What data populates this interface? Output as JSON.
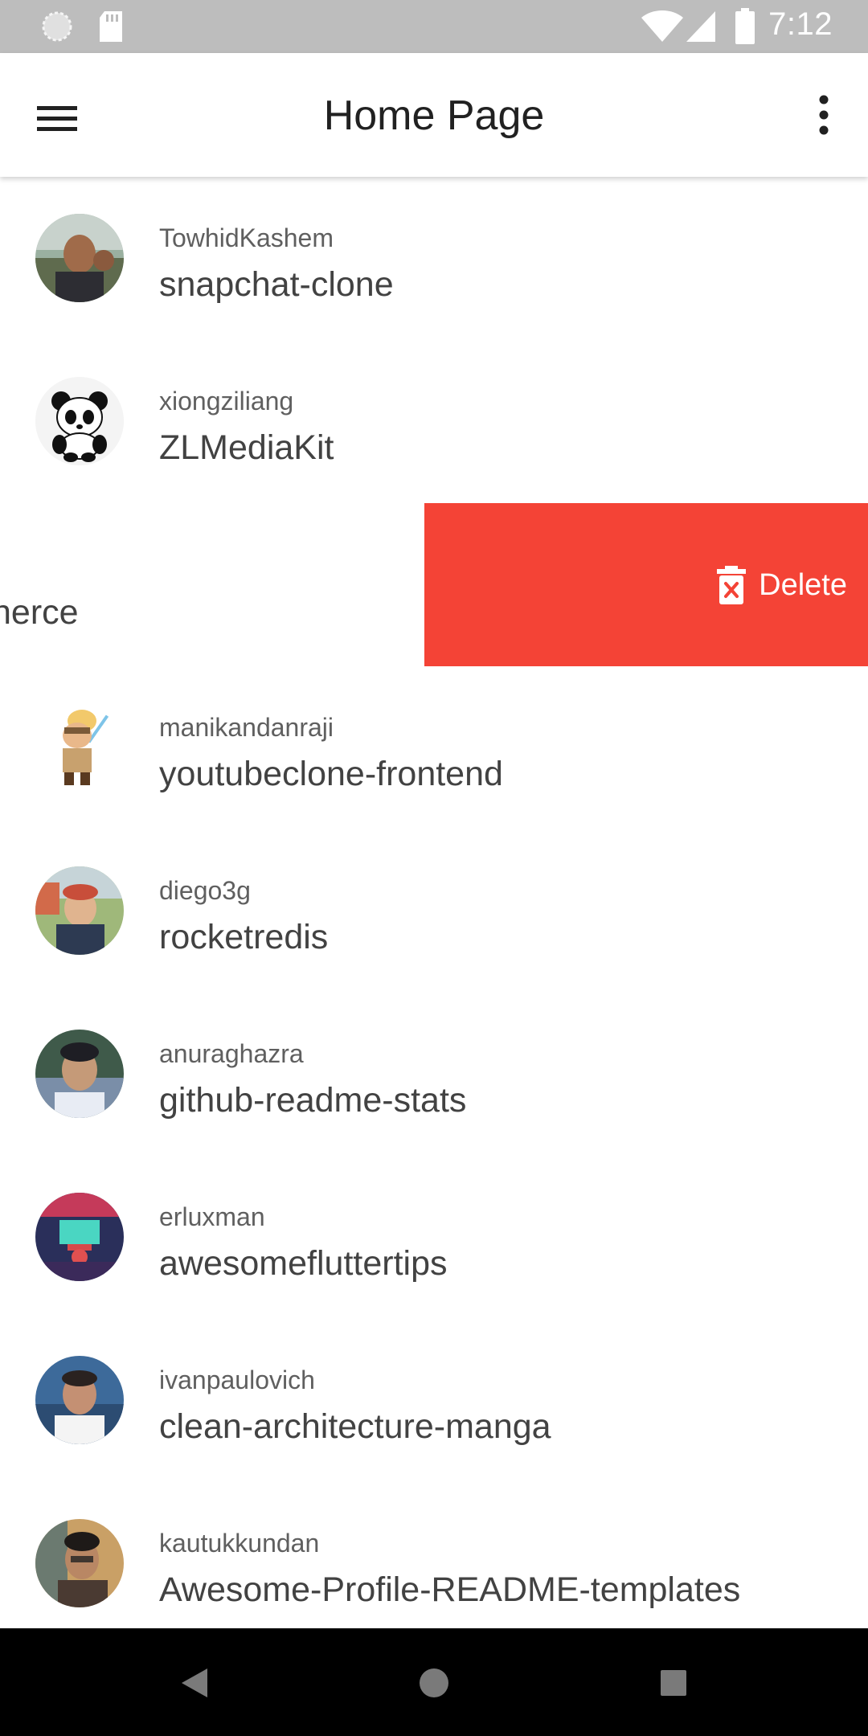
{
  "status_bar": {
    "time": "7:12",
    "icons": [
      "sync-icon",
      "sd-card-icon",
      "wifi-icon",
      "signal-icon",
      "battery-icon"
    ],
    "background": "#bdbdbd"
  },
  "app_bar": {
    "title": "Home Page",
    "menu_icon": "menu-icon",
    "more_icon": "more-vert-icon"
  },
  "repos": [
    {
      "owner": "TowhidKashem",
      "name": "snapchat-clone"
    },
    {
      "owner": "xiongziliang",
      "name": "ZLMediaKit"
    },
    {
      "owner": "",
      "name": "nerce",
      "swiped": true
    },
    {
      "owner": "manikandanraji",
      "name": "youtubeclone-frontend"
    },
    {
      "owner": "diego3g",
      "name": "rocketredis"
    },
    {
      "owner": "anuraghazra",
      "name": "github-readme-stats"
    },
    {
      "owner": "erluxman",
      "name": "awesomefluttertips"
    },
    {
      "owner": "ivanpaulovich",
      "name": "clean-architecture-manga"
    },
    {
      "owner": "kautukkundan",
      "name": "Awesome-Profile-README-templates"
    }
  ],
  "swipe_action": {
    "label": "Delete",
    "icon": "delete-forever-icon",
    "color": "#f44336"
  },
  "nav_bar": {
    "icons": [
      "back-icon",
      "home-icon",
      "recents-icon"
    ]
  }
}
